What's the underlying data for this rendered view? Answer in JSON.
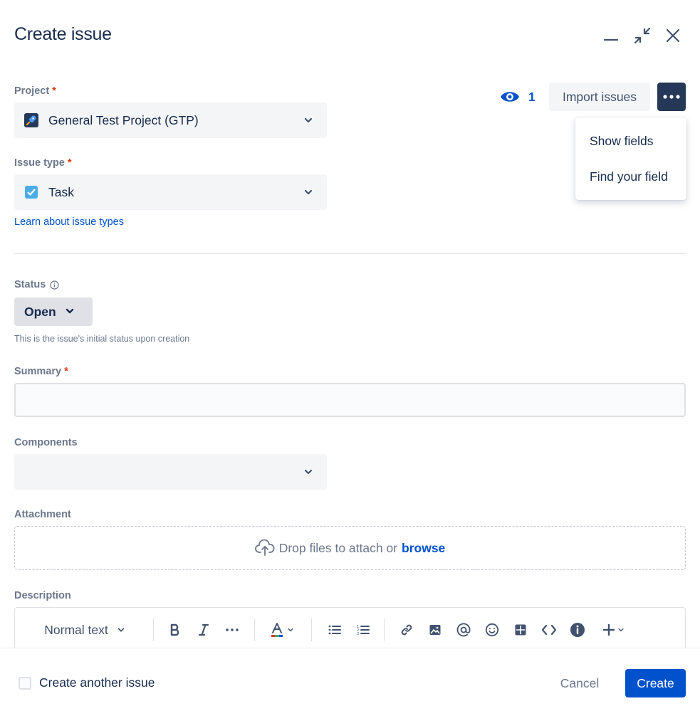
{
  "dialog": {
    "title": "Create issue"
  },
  "header_actions": {
    "watchers_count": "1",
    "import_label": "Import issues"
  },
  "more_menu": {
    "items": [
      "Show fields",
      "Find your field"
    ]
  },
  "project": {
    "label": "Project",
    "required_mark": "*",
    "value": "General Test Project (GTP)"
  },
  "issue_type": {
    "label": "Issue type",
    "required_mark": "*",
    "value": "Task",
    "learn_link": "Learn about issue types"
  },
  "status": {
    "label": "Status",
    "value": "Open",
    "helper": "This is the issue's initial status upon creation"
  },
  "summary": {
    "label": "Summary",
    "required_mark": "*",
    "value": ""
  },
  "components": {
    "label": "Components",
    "value": ""
  },
  "attachment": {
    "label": "Attachment",
    "drop_text": "Drop files to attach or",
    "browse_text": "browse"
  },
  "description": {
    "label": "Description",
    "text_style": "Normal text"
  },
  "footer": {
    "create_another_label": "Create another issue",
    "create_another_checked": false,
    "cancel_label": "Cancel",
    "create_label": "Create"
  },
  "colors": {
    "primary": "#0052CC",
    "text": "#172B4D",
    "subtle_text": "#6B778C",
    "required": "#DE350B",
    "more_button_bg": "#253858"
  }
}
